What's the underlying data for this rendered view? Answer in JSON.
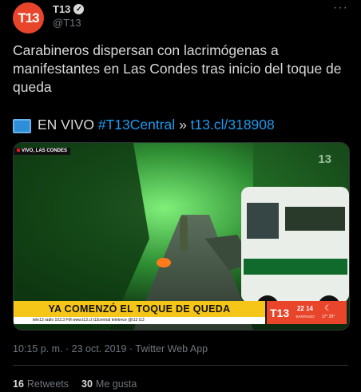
{
  "account": {
    "avatar_text": "T13",
    "name": "T13",
    "handle": "@T13",
    "more_glyph": "···",
    "verified_glyph": "✓"
  },
  "tweet": {
    "text": "Carabineros dispersan con lacrimógenas a manifestantes en Las Condes tras inicio del toque de queda",
    "live_prefix": "EN VIVO",
    "hashtag": "#T13Central",
    "arrow": "»",
    "link": "t13.cl/318908"
  },
  "media": {
    "live_tag": "VIVO, LAS CONDES",
    "corner_logo": "13",
    "banner": "YA COMENZÓ EL TOQUE DE QUEDA",
    "ticker": "tele13 radio 103.3 FM   www.t13.cl   t13central   teletrece   @t13   t13",
    "brand_logo": "T13",
    "clock_time": "22 14",
    "clock_city": "SANTIAGO",
    "weather": "17°  29°"
  },
  "meta": {
    "timestamp": "10:15 p. m. · 23 oct. 2019 · Twitter Web App"
  },
  "stats": {
    "retweets_count": "16",
    "retweets_label": "Retweets",
    "likes_count": "30",
    "likes_label": "Me gusta"
  },
  "colors": {
    "background": "#000000",
    "text": "#d9d9d9",
    "muted": "#6e767d",
    "link": "#1d9bf0",
    "brand": "#e8452b",
    "banner": "#f5c518"
  }
}
